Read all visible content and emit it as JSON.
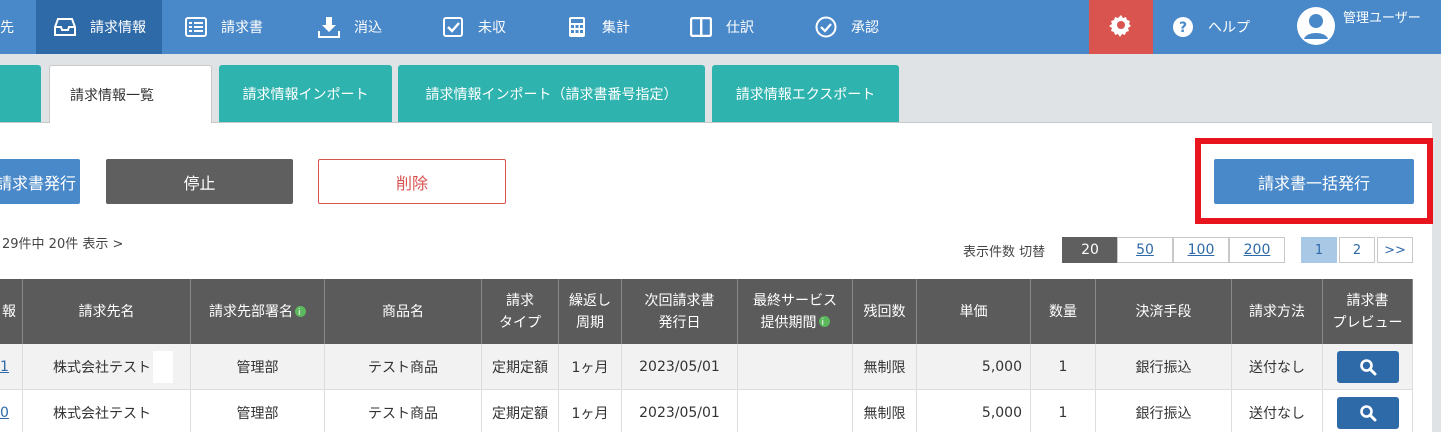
{
  "nav": {
    "items": [
      {
        "label": "先",
        "icon": "partial-icon"
      },
      {
        "label": "請求情報",
        "icon": "inbox-icon"
      },
      {
        "label": "請求書",
        "icon": "list-icon"
      },
      {
        "label": "消込",
        "icon": "download-icon"
      },
      {
        "label": "未収",
        "icon": "checkbox-icon"
      },
      {
        "label": "集計",
        "icon": "calculator-icon"
      },
      {
        "label": "仕訳",
        "icon": "columns-icon"
      },
      {
        "label": "承認",
        "icon": "check-circle-icon"
      }
    ],
    "help_label": "ヘルプ",
    "user_label": "管理ユーザー"
  },
  "tabs": [
    "請求情報一覧",
    "請求情報インポート",
    "請求情報インポート（請求書番号指定）",
    "請求情報エクスポート"
  ],
  "actions": {
    "issue_label": "請求書発行",
    "stop_label": "停止",
    "delete_label": "削除",
    "bulk_issue_label": "請求書一括発行"
  },
  "listing": {
    "count_text": "29件中 20件 表示 >",
    "per_page_label": "表示件数 切替",
    "per_page_options": [
      "20",
      "50",
      "100",
      "200"
    ],
    "pages": [
      "1",
      "2",
      ">>"
    ]
  },
  "table": {
    "headers": [
      "報",
      "請求先名",
      "請求先部署名",
      "商品名",
      "請求タイプ",
      "繰返し周期",
      "次回請求書発行日",
      "最終サービス提供期間",
      "残回数",
      "単価",
      "数量",
      "決済手段",
      "請求方法",
      "請求書プレビュー"
    ],
    "header_lines": {
      "type": [
        "請求",
        "タイプ"
      ],
      "cycle": [
        "繰返し",
        "周期"
      ],
      "next": [
        "次回請求書",
        "発行日"
      ],
      "service": [
        "最終サービス",
        "提供期間"
      ],
      "preview": [
        "請求書",
        "プレビュー"
      ]
    },
    "rows": [
      {
        "id": "1",
        "customer": "株式会社テスト",
        "dept": "管理部",
        "product": "テスト商品",
        "type": "定期定額",
        "cycle": "1ヶ月",
        "next_date": "2023/05/01",
        "service": "",
        "remaining": "無制限",
        "price": "5,000",
        "qty": "1",
        "payment": "銀行振込",
        "method": "送付なし"
      },
      {
        "id": "0",
        "customer": "株式会社テスト",
        "dept": "管理部",
        "product": "テスト商品",
        "type": "定期定額",
        "cycle": "1ヶ月",
        "next_date": "2023/05/01",
        "service": "",
        "remaining": "無制限",
        "price": "5,000",
        "qty": "1",
        "payment": "銀行振込",
        "method": "送付なし"
      }
    ]
  },
  "colors": {
    "nav": "#4a89c9",
    "nav_active": "#2e6aa8",
    "tab": "#2fb3ae",
    "danger": "#d9534f",
    "highlight": "#e8141e"
  }
}
